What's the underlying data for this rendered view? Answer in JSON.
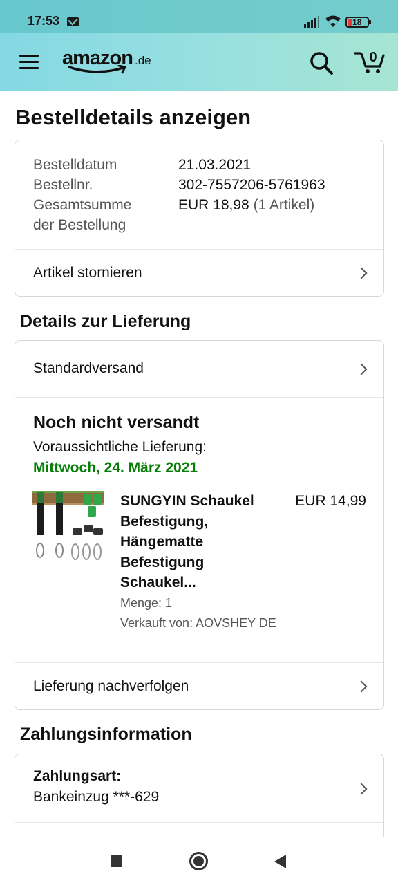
{
  "status_bar": {
    "time": "17:53",
    "battery": "18",
    "icons": [
      "mail-icon",
      "signal-icon",
      "wifi-icon",
      "battery-icon"
    ]
  },
  "header": {
    "logo_word": "amazon",
    "logo_tld": ".de",
    "cart_count": "0",
    "icons": [
      "menu-icon",
      "search-icon",
      "cart-icon"
    ],
    "colors": {
      "header_start": "#84d8e3",
      "header_end": "#a6e5d2",
      "smile": "#111111"
    }
  },
  "page": {
    "title": "Bestelldetails anzeigen"
  },
  "order_summary": {
    "date_label": "Bestelldatum",
    "date_value": "21.03.2021",
    "number_label": "Bestellnr.",
    "number_value": "302-7557206-5761963",
    "total_label_line1": "Gesamtsumme",
    "total_label_line2": "der Bestellung",
    "total_value": "EUR 18,98",
    "total_items": "(1 Artikel)",
    "cancel_label": "Artikel stornieren"
  },
  "delivery": {
    "section_title": "Details zur Lieferung",
    "shipping_method": "Standardversand",
    "status": "Noch nicht versandt",
    "expected_label": "Voraussichtliche Lieferung:",
    "expected_date": "Mittwoch, 24. März 2021",
    "date_color": "#067d06",
    "product": {
      "title": "SUNGYIN Schaukel Befestigung, Hängematte Befestigung Schaukel...",
      "price": "EUR 14,99",
      "quantity": "Menge: 1",
      "seller": "Verkauft von: AOVSHEY DE"
    },
    "track_label": "Lieferung nachverfolgen"
  },
  "payment": {
    "section_title": "Zahlungsinformation",
    "method_label": "Zahlungsart:",
    "method_value": "Bankeinzug ***-629"
  },
  "nav_bar": {
    "icons": [
      "recent-apps-icon",
      "home-icon",
      "back-icon"
    ]
  }
}
